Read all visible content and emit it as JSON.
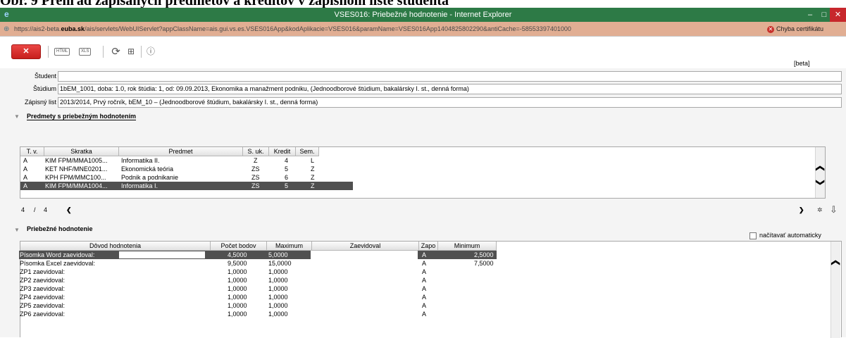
{
  "document_caption": "Obr. 9 Prehľad zapísaných predmetov a kreditov v zápisnom liste študenta",
  "window": {
    "title": "VSES016: Priebežné hodnotenie - Internet Explorer",
    "logo": "e",
    "minimize": "–",
    "maximize": "□",
    "close": "✕"
  },
  "address": {
    "url_prefix": "https://ais2-beta.",
    "url_domain": "euba.sk",
    "url_rest": "/ais/servlets/WebUIServlet?appClassName=ais.gui.vs.es.VSES016App&kodAplikacie=VSES016&paramName=VSES016App1404825802290&antiCache=-58553397401000",
    "cert_error": "Chyba certifikátu",
    "cert_icon": "✕"
  },
  "toolbar": {
    "close_label": "✕",
    "html_label": "HTML",
    "xls_label": "XLS",
    "reload_icon": "⟳",
    "tree_icon": "⊞",
    "info_icon": "ⓘ",
    "beta_label": "[beta]"
  },
  "form": {
    "student_label": "Študent",
    "student_value": "",
    "study_label": "Štúdium",
    "study_value": "1bEM_1001, doba: 1.0, rok štúdia: 1, od: 09.09.2013, Ekonomika a manažment podniku, (Jednoodborové štúdium, bakalársky I. st., denná forma)",
    "enroll_label": "Zápisný list",
    "enroll_value": "2013/2014, Prvý ročník, bEM_10 – (Jednoodborové štúdium, bakalársky I. st., denná forma)"
  },
  "subjects": {
    "section_title": "Predmety s priebežným hodnotením",
    "columns": [
      "T. v.",
      "Skratka",
      "Predmet",
      "S. uk.",
      "Kredit",
      "Sem."
    ],
    "rows": [
      {
        "tv": "A",
        "code": "KIM FPM/MMA1005...",
        "name": "Informatika II.",
        "suk": "Z",
        "credit": "4",
        "sem": "L"
      },
      {
        "tv": "A",
        "code": "KET NHF/MNE0201...",
        "name": "Ekonomická teória",
        "suk": "ZS",
        "credit": "5",
        "sem": "Z"
      },
      {
        "tv": "A",
        "code": "KPH FPM/MMC100...",
        "name": "Podnik a podnikanie",
        "suk": "ZS",
        "credit": "6",
        "sem": "Z"
      },
      {
        "tv": "A",
        "code": "KIM FPM/MMA1004...",
        "name": "Informatika I.",
        "suk": "ZS",
        "credit": "5",
        "sem": "Z"
      }
    ],
    "selected_index": 3,
    "pager_current": "4",
    "pager_sep": "/",
    "pager_total": "4",
    "pager_prev": "❮",
    "pager_next": "❯"
  },
  "evaluation": {
    "section_title": "Priebežné hodnotenie",
    "autoload_label": "načítavať automaticky",
    "columns": [
      "Dôvod hodnotenia",
      "Počet bodov",
      "Maximum",
      "Zaevidoval",
      "Zapo",
      "Minimum"
    ],
    "rows": [
      {
        "reason": "Písomka Word zaevidoval:",
        "points": "4,5000",
        "max": "5,0000",
        "by": "",
        "zapo": "A",
        "min": "2,5000"
      },
      {
        "reason": "Písomka Excel zaevidoval:",
        "points": "9,5000",
        "max": "15,0000",
        "by": "",
        "zapo": "A",
        "min": "7,5000"
      },
      {
        "reason": "ZP1 zaevidoval:",
        "points": "1,0000",
        "max": "1,0000",
        "by": "",
        "zapo": "A",
        "min": ""
      },
      {
        "reason": "ZP2 zaevidoval:",
        "points": "1,0000",
        "max": "1,0000",
        "by": "",
        "zapo": "A",
        "min": ""
      },
      {
        "reason": "ZP3 zaevidoval:",
        "points": "1,0000",
        "max": "1,0000",
        "by": "",
        "zapo": "A",
        "min": ""
      },
      {
        "reason": "ZP4 zaevidoval:",
        "points": "1,0000",
        "max": "1,0000",
        "by": "",
        "zapo": "A",
        "min": ""
      },
      {
        "reason": "ZP5 zaevidoval:",
        "points": "1,0000",
        "max": "1,0000",
        "by": "",
        "zapo": "A",
        "min": ""
      },
      {
        "reason": "ZP6 zaevidoval:",
        "points": "1,0000",
        "max": "1,0000",
        "by": "",
        "zapo": "A",
        "min": ""
      }
    ],
    "selected_index": 0
  },
  "icons": {
    "collapse": "▼",
    "scroll_up": "❮",
    "scroll_down": "❯",
    "gear": "✲",
    "download": "⇩"
  }
}
